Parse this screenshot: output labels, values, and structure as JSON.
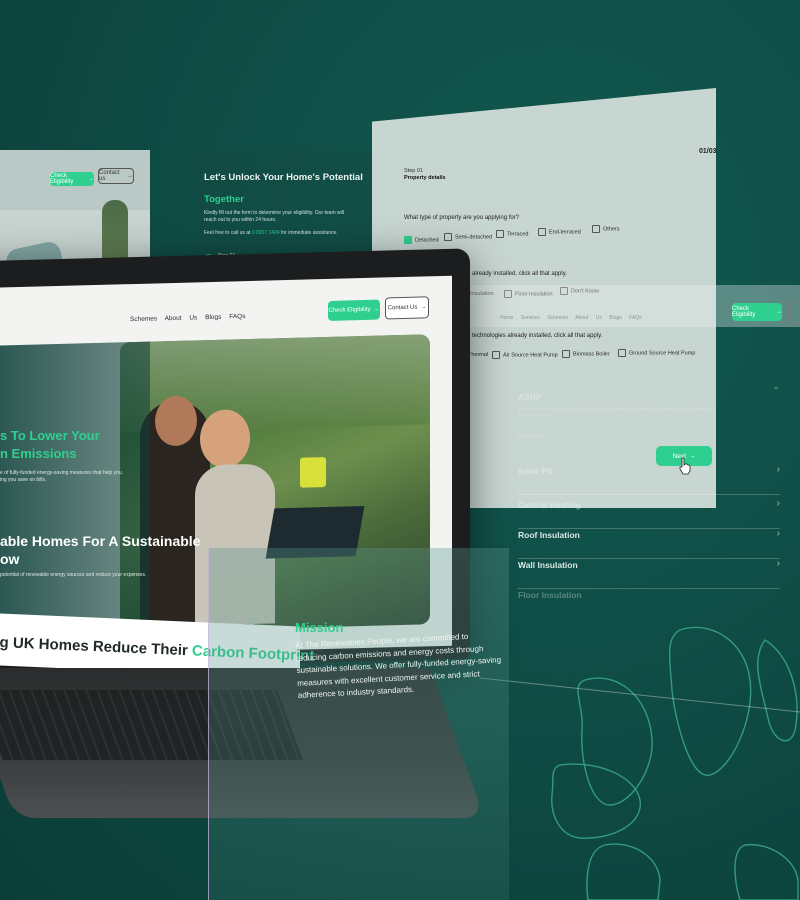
{
  "nav": {
    "check_eligibility": "Check Eligibility",
    "contact_us": "Contact Us",
    "contact_us_small": "Contact us",
    "links": [
      "Schemes",
      "About Us",
      "Blogs",
      "FAQs"
    ],
    "arrow": "→"
  },
  "form_intro": {
    "title": "Let's Unlock Your Home's Potential",
    "title_accent": "Together",
    "body": "Kindly fill out the form to determine your eligibility. Our team will reach out to you within 24 hours.",
    "call_prefix": "Feel free to call us at",
    "phone": "0 0207 1424",
    "call_suffix": "for immediate assistance.",
    "step_label": "Step 01",
    "step_name": "Property Details"
  },
  "form": {
    "step_label": "Step 01",
    "step_name": "Property details",
    "counter": "01/03",
    "q1": "What type of property are you applying for?",
    "property_types": [
      {
        "label": "Detached",
        "checked": true
      },
      {
        "label": "Semi-detached",
        "checked": false
      },
      {
        "label": "Terraced",
        "checked": false
      },
      {
        "label": "End-terraced",
        "checked": false
      },
      {
        "label": "Others",
        "checked": false
      }
    ],
    "q2": "already installed, click all that apply.",
    "insulation_options": [
      "Insulation",
      "Floor Insulation",
      "Don't Know"
    ],
    "q3": "technologies already installed, click all that apply.",
    "tech_options": [
      "Thermal",
      "Air Source Heat Pump",
      "Biomass Boiler",
      "Ground Source Heat Pump"
    ],
    "next": "Next"
  },
  "ghost_nav": [
    "Home",
    "Services",
    "Schemes",
    "About Us",
    "Blogs",
    "FAQs"
  ],
  "accordion": {
    "open_title": "ASHP",
    "open_body": "Moving out the costs of a modern heating can increase heat technology, offering energy efficiency and sustainability.",
    "learn_more": "Learn More",
    "items": [
      "Solar PV",
      "Central Heating",
      "Roof Insulation",
      "Wall Insulation",
      "Floor Insulation"
    ]
  },
  "hero": {
    "headline_a_part1": "s To Lower Your",
    "headline_a_part2": "n Emissions",
    "sub_a": "e of fully-funded energy-saving measures that help you",
    "sub_a2": "ing you save on bills.",
    "headline_b_line1": "able Homes For A Sustainable",
    "headline_b_line2": "ow",
    "sub_b": "potential of renewable energy sources and reduce your expenses."
  },
  "banner": {
    "text": "g UK Homes Reduce Their",
    "accent": "Carbon Footprint"
  },
  "mission": {
    "title": "Mission",
    "body": "At The Renewables People, we are committed to reducing carbon emissions and energy costs through sustainable solutions. We offer fully-funded energy-saving measures with excellent customer service and strict adherence to industry standards."
  },
  "colors": {
    "brand_green": "#2fd08f",
    "background": "#0e4a43",
    "dark_text": "#1f2a28"
  }
}
